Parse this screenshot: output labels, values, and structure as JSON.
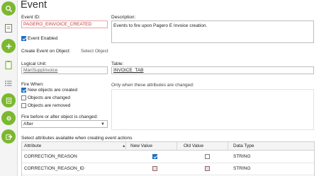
{
  "page": {
    "title": "Event"
  },
  "form": {
    "event_id_label": "Event ID:",
    "event_id_value": "PAGERO_EINVOICE_CREATED",
    "description_label": "Description:",
    "description_value": "Events to fire upon Pagero E Invoice creation.",
    "event_enabled_label": "Event Enabled",
    "create_event_label": "Create Event on Object:",
    "create_event_value": "Select Object",
    "logical_unit_label": "Logical Unit:",
    "logical_unit_value": "ManSuppInvoice",
    "table_label": "Table:",
    "table_value": "INVOICE_TAB",
    "fire_when_label": "Fire When:",
    "fire_options": [
      "New objects are created",
      "Objects are changed",
      "Objects are removed"
    ],
    "changed_attrs_label": "Only when these attributes are changed:",
    "before_after_label": "Fire before or after object is changed:",
    "before_after_value": "After",
    "select_attrs_label": "Select attributes available when creating event actions"
  },
  "attr_table": {
    "columns": [
      "Attribute",
      "New Value",
      "Old Value",
      "Data Type"
    ],
    "rows": [
      {
        "attribute": "CORRECTION_REASON",
        "new_value": true,
        "old_value": false,
        "data_type": "STRING"
      },
      {
        "attribute": "CORRECTION_REASON_ID",
        "new_value": false,
        "old_value": false,
        "data_type": "STRING"
      }
    ]
  },
  "icons": {
    "sidebar": [
      "search-icon",
      "document-icon",
      "add-icon",
      "clipboard-icon",
      "list-icon",
      "checklist-icon",
      "settings-icon",
      "export-icon"
    ],
    "accent_color": "#7cb82f",
    "check_color": "#1e6fc2"
  }
}
